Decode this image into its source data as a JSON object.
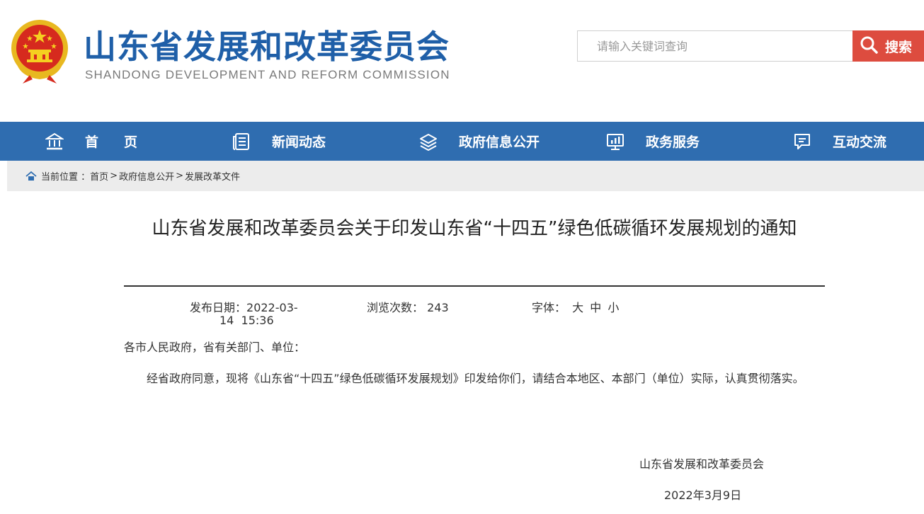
{
  "header": {
    "title": "山东省发展和改革委员会",
    "subtitle": "SHANDONG DEVELOPMENT AND REFORM COMMISSION",
    "emblem_icon": "national-emblem-icon"
  },
  "search": {
    "placeholder": "请输入关键词查询",
    "button_label": "搜索",
    "button_color": "#dd4c3f"
  },
  "nav": {
    "color": "#2f6db0",
    "items": [
      {
        "label": "首页",
        "icon": "home-icon"
      },
      {
        "label": "新闻动态",
        "icon": "news-icon"
      },
      {
        "label": "政府信息公开",
        "icon": "layers-icon"
      },
      {
        "label": "政务服务",
        "icon": "service-icon"
      },
      {
        "label": "互动交流",
        "icon": "chat-icon"
      }
    ]
  },
  "breadcrumb": {
    "prefix": "当前位置 ：",
    "items": [
      "首页",
      "政府信息公开",
      "发展改革文件"
    ]
  },
  "article": {
    "title": "山东省发展和改革委员会关于印发山东省“十四五”绿色低碳循环发展规划的通知",
    "meta": {
      "date_label": "发布日期：",
      "date_line1": "2022-03-",
      "date_line2": "14  15:36",
      "views_label": "浏览次数：",
      "views_value": "243",
      "font_label": "字体：",
      "font_sizes": [
        "大",
        "中",
        "小"
      ]
    },
    "salutation": "各市人民政府，省有关部门、单位：",
    "body": "经省政府同意，现将《山东省“十四五”绿色低碳循环发展规划》印发给你们，请结合本地区、本部门（单位）实际，认真贯彻落实。",
    "signature_org": "山东省发展和改革委员会",
    "signature_date": "2022年3月9日"
  }
}
